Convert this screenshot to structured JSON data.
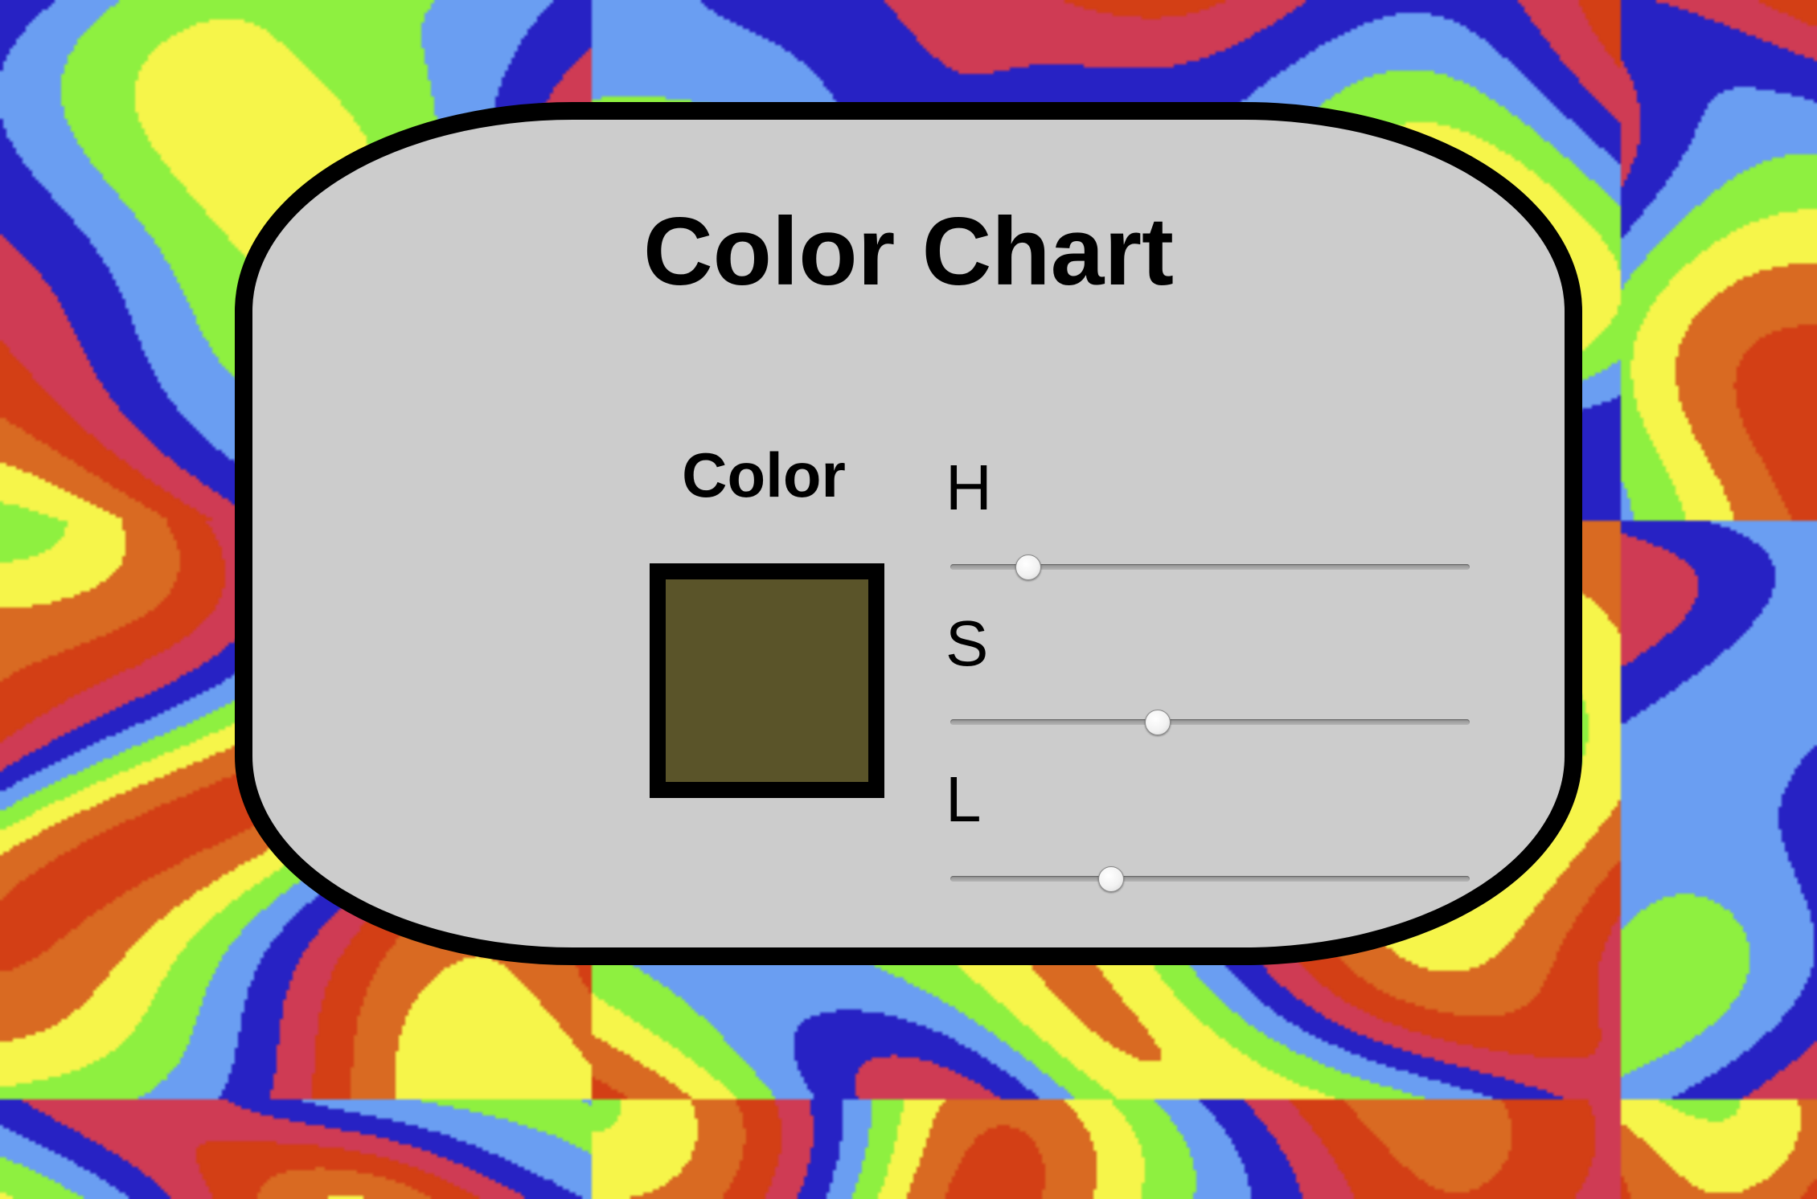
{
  "app": {
    "title": "Color Chart"
  },
  "colors": {
    "panel_background": "#cccccc",
    "panel_border": "#000000",
    "swatch_color": "#5a5429",
    "background_palette": [
      "#d33f15",
      "#d96a22",
      "#f6f54a",
      "#8ef040",
      "#6a9ef2",
      "#2722c4",
      "#cf3b54"
    ]
  },
  "swatch": {
    "label": "Color"
  },
  "sliders": [
    {
      "label": "H",
      "fraction": 0.15
    },
    {
      "label": "S",
      "fraction": 0.4
    },
    {
      "label": "L",
      "fraction": 0.31
    }
  ]
}
